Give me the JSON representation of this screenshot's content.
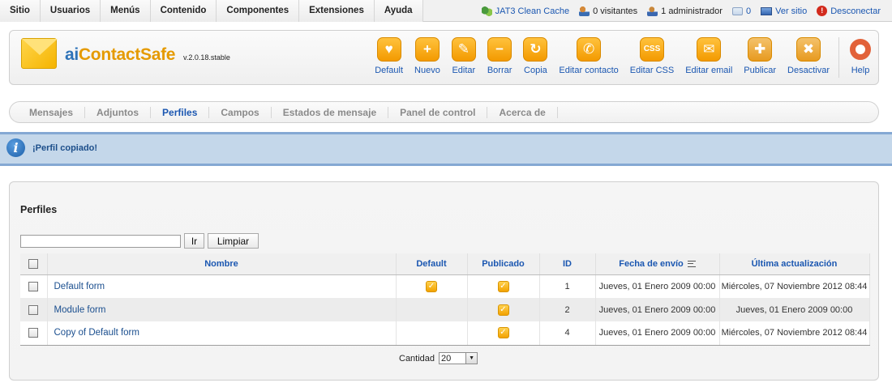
{
  "topmenu": {
    "items": [
      "Sitio",
      "Usuarios",
      "Menús",
      "Contenido",
      "Componentes",
      "Extensiones",
      "Ayuda"
    ]
  },
  "status": {
    "cache": "JAT3 Clean Cache",
    "visitors": "0 visitantes",
    "admins": "1 administrador",
    "messages": "0",
    "view_site": "Ver sitio",
    "logout": "Desconectar"
  },
  "header": {
    "title_prefix": "ai",
    "title_main": "ContactSafe",
    "version": "v.2.0.18.stable"
  },
  "toolbar": {
    "default": "Default",
    "new": "Nuevo",
    "edit": "Editar",
    "delete": "Borrar",
    "copy": "Copia",
    "edit_contact": "Editar contacto",
    "edit_css": "Editar CSS",
    "edit_email": "Editar email",
    "publish": "Publicar",
    "unpublish": "Desactivar",
    "help": "Help",
    "css_glyph": "CSS"
  },
  "submenu": {
    "items": [
      "Mensajes",
      "Adjuntos",
      "Perfiles",
      "Campos",
      "Estados de mensaje",
      "Panel de control",
      "Acerca de"
    ],
    "active": "Perfiles"
  },
  "message": "¡Perfil copiado!",
  "content": {
    "title": "Perfiles",
    "filter_value": "",
    "go_label": "Ir",
    "reset_label": "Limpiar",
    "columns": {
      "name": "Nombre",
      "default": "Default",
      "published": "Publicado",
      "id": "ID",
      "date": "Fecha de envío",
      "updated": "Última actualización"
    },
    "rows": [
      {
        "name": "Default form",
        "default": true,
        "published": true,
        "id": "1",
        "date": "Jueves, 01 Enero 2009 00:00",
        "updated": "Miércoles, 07 Noviembre 2012 08:44"
      },
      {
        "name": "Module form",
        "default": false,
        "published": true,
        "id": "2",
        "date": "Jueves, 01 Enero 2009 00:00",
        "updated": "Jueves, 01 Enero 2009 00:00"
      },
      {
        "name": "Copy of Default form",
        "default": false,
        "published": true,
        "id": "4",
        "date": "Jueves, 01 Enero 2009 00:00",
        "updated": "Miércoles, 07 Noviembre 2012 08:44"
      }
    ],
    "pager": {
      "label": "Cantidad",
      "limit": "20"
    }
  }
}
